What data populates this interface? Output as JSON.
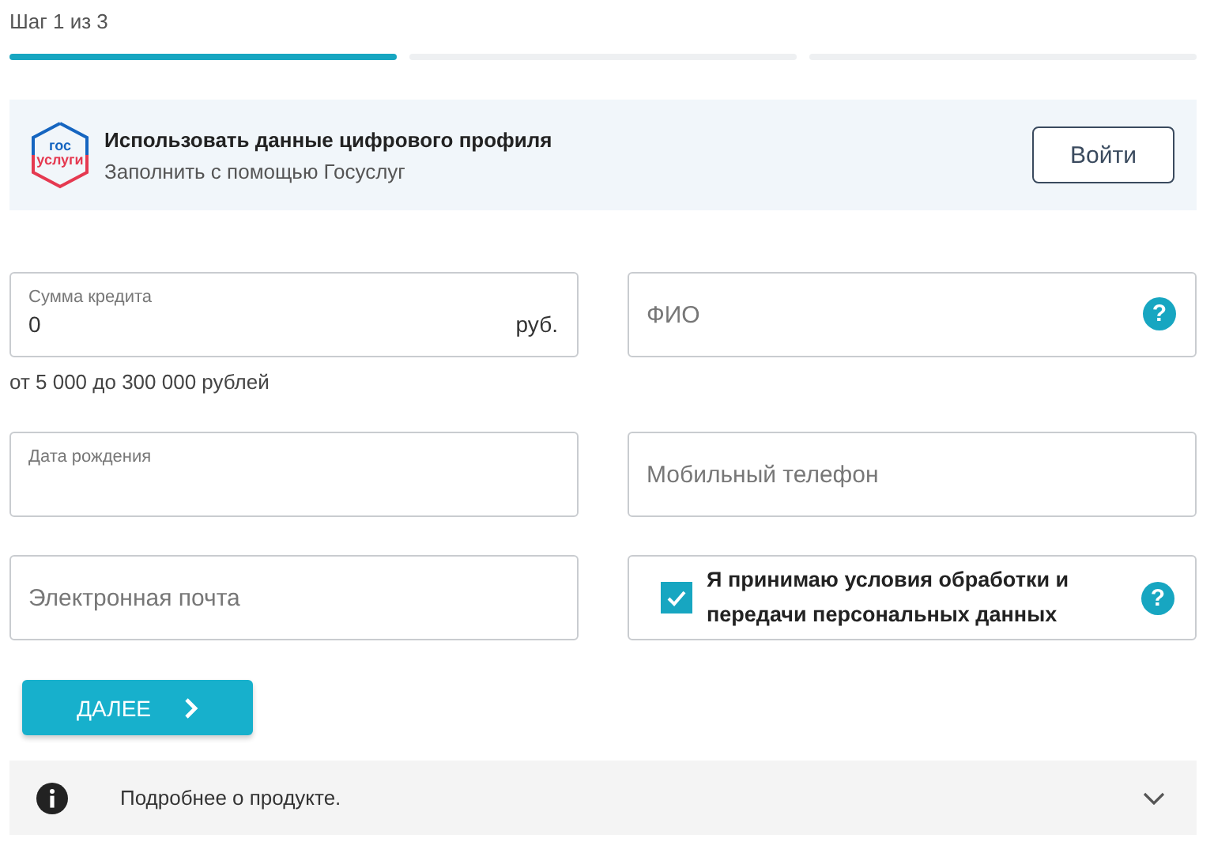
{
  "step_label": "Шаг 1 из 3",
  "steps": [
    {
      "done": true
    },
    {
      "done": false
    },
    {
      "done": false
    }
  ],
  "gosuslugi": {
    "logo_lines": [
      "гос",
      "услуги"
    ],
    "title": "Использовать данные цифрового профиля",
    "subtitle": "Заполнить с помощью Госуслуг",
    "button": "Войти"
  },
  "fields": [
    {
      "kind": "floating",
      "label": "Сумма кредита",
      "value": "0",
      "suffix": "руб.",
      "hint": "от 5 000 до 300 000 рублей"
    },
    {
      "kind": "plain",
      "placeholder": "ФИО",
      "help": "?"
    },
    {
      "kind": "floating",
      "label": "Дата рождения"
    },
    {
      "kind": "plain",
      "placeholder": "Мобильный телефон"
    },
    {
      "kind": "plain",
      "placeholder": "Электронная почта"
    },
    {
      "kind": "checkbox",
      "label": "Я принимаю условия обработки и передачи персональных данных",
      "checked": true,
      "help": "?"
    }
  ],
  "next_button": "ДАЛЕЕ",
  "info_bar": {
    "text": "Подробнее о продукте.",
    "expanded": false
  }
}
